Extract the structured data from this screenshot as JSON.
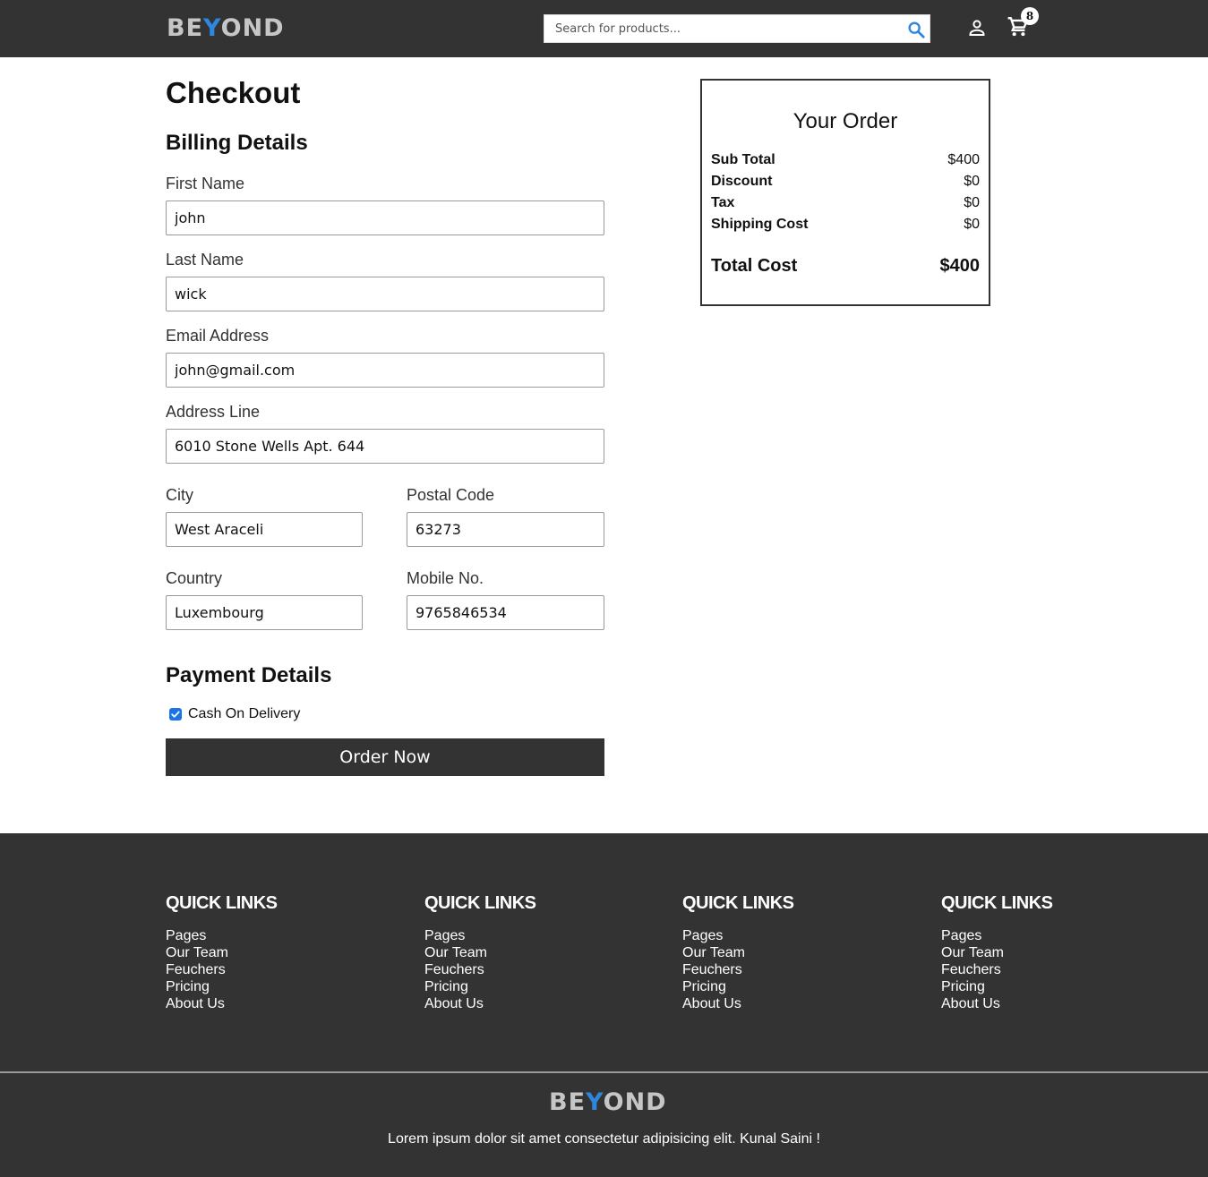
{
  "header": {
    "logo_part1": "BE",
    "logo_part2": "Y",
    "logo_part3": "OND",
    "search_placeholder": "Search for products...",
    "cart_count": "8",
    "icons": [
      "search-icon",
      "user-icon",
      "cart-icon"
    ]
  },
  "checkout": {
    "title": "Checkout",
    "billing_title": "Billing Details",
    "fields": {
      "first_name": {
        "label": "First Name",
        "value": "john"
      },
      "last_name": {
        "label": "Last Name",
        "value": "wick"
      },
      "email": {
        "label": "Email Address",
        "value": "john@gmail.com"
      },
      "address": {
        "label": "Address Line",
        "value": "6010 Stone Wells Apt. 644"
      },
      "city": {
        "label": "City",
        "value": "West Araceli"
      },
      "postal_code": {
        "label": "Postal Code",
        "value": "63273"
      },
      "country": {
        "label": "Country",
        "value": "Luxembourg"
      },
      "mobile": {
        "label": "Mobile No.",
        "value": "9765846534"
      }
    },
    "payment_title": "Payment Details",
    "payment_option": "Cash On Delivery",
    "payment_checked": true,
    "order_button": "Order Now"
  },
  "order_summary": {
    "title": "Your Order",
    "rows": [
      {
        "label": "Sub Total",
        "value": "$400"
      },
      {
        "label": "Discount",
        "value": "$0"
      },
      {
        "label": "Tax",
        "value": "$0"
      },
      {
        "label": "Shipping Cost",
        "value": "$0"
      }
    ],
    "total_label": "Total Cost",
    "total_value": "$400"
  },
  "footer": {
    "columns": [
      {
        "heading": "QUICK LINKS",
        "links": [
          "Pages",
          "Our Team",
          "Feuchers",
          "Pricing",
          "About Us"
        ]
      },
      {
        "heading": "QUICK LINKS",
        "links": [
          "Pages",
          "Our Team",
          "Feuchers",
          "Pricing",
          "About Us"
        ]
      },
      {
        "heading": "QUICK LINKS",
        "links": [
          "Pages",
          "Our Team",
          "Feuchers",
          "Pricing",
          "About Us"
        ]
      },
      {
        "heading": "QUICK LINKS",
        "links": [
          "Pages",
          "Our Team",
          "Feuchers",
          "Pricing",
          "About Us"
        ]
      }
    ],
    "copyright": "Lorem ipsum dolor sit amet consectetur adipisicing elit. Kunal Saini !"
  },
  "colors": {
    "header_bg": "#333333",
    "footer_bg": "#333333",
    "accent": "#2e86de",
    "checkbox": "#1a73e8"
  }
}
